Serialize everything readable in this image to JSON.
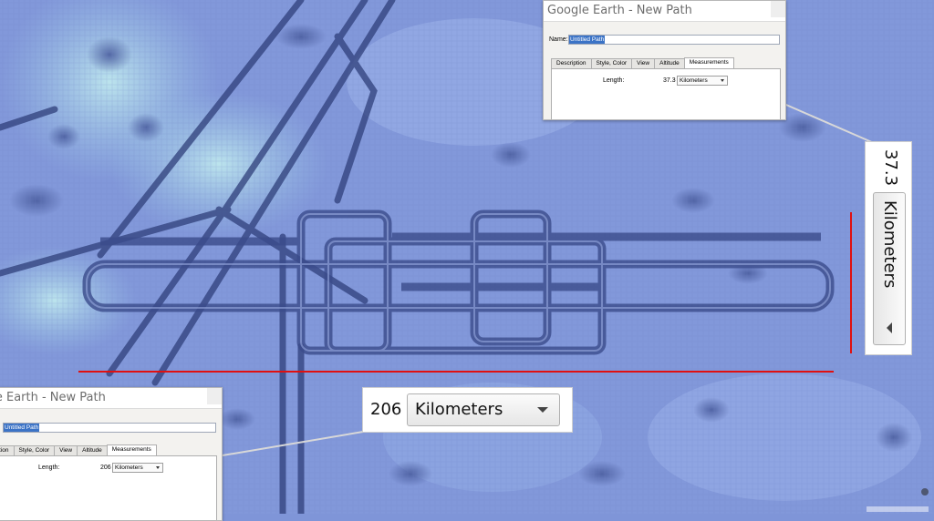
{
  "window_title": "Google Earth - New Path",
  "name_label": "Name:",
  "name_value": "Untitled Path",
  "tabs": [
    "Description",
    "Style, Color",
    "View",
    "Altitude",
    "Measurements"
  ],
  "length_label": "Length:",
  "top_dialog": {
    "length_value": "37.3",
    "unit": "Kilometers"
  },
  "bottom_dialog": {
    "length_value": "206",
    "unit": "Kilometers"
  },
  "horizontal_callout": {
    "value": "206",
    "unit": "Kilometers"
  },
  "vertical_callout": {
    "value": "37.3",
    "unit": "Kilometers"
  },
  "colors": {
    "measure_line": "#e01010",
    "map_base": "#7f95d8",
    "selection": "#3b73c6"
  },
  "icons": [
    "chevron-down-icon",
    "chevron-left-icon",
    "watermark"
  ]
}
